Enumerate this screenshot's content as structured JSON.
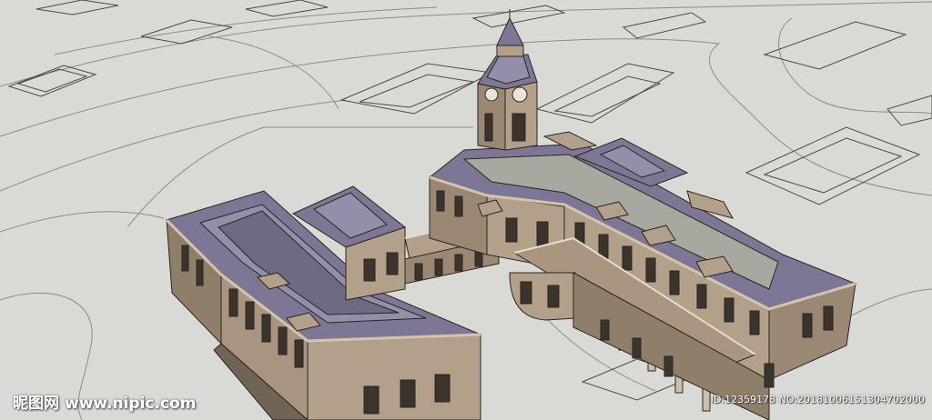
{
  "watermark": {
    "logo_text": "昵图网",
    "site": "www.nipic.com",
    "image_id": "ID:12359178 NO:20181006151304702000"
  },
  "colors": {
    "ground": "#d9dad6",
    "lines": "#8a8c88",
    "wall": "#b3a08a",
    "wall_dark": "#8f7e6a",
    "roof": "#7d7694",
    "roof_light": "#948eab",
    "roof_flat": "#a7a8a0"
  }
}
